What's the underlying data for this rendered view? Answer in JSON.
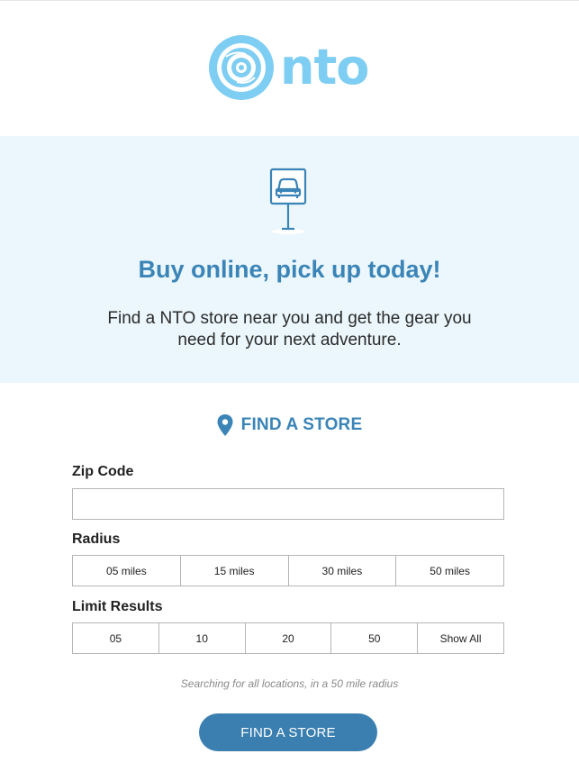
{
  "brand": {
    "logo_text": "nto",
    "logo_color": "#7ecdf2"
  },
  "hero": {
    "icon": "parking-sign-car-icon",
    "title": "Buy online, pick up today!",
    "text": "Find a NTO store near you and get the gear you need for your next adventure.",
    "background": "#ebf7fc"
  },
  "finder": {
    "heading": "FIND A STORE",
    "heading_icon": "map-pin-icon",
    "zip_label": "Zip Code",
    "zip_value": "",
    "radius_label": "Radius",
    "radius_options": [
      "05 miles",
      "15 miles",
      "30 miles",
      "50 miles"
    ],
    "limit_label": "Limit Results",
    "limit_options": [
      "05",
      "10",
      "20",
      "50",
      "Show All"
    ],
    "search_note": "Searching for all locations, in a 50 mile radius",
    "submit_label": "FIND A STORE",
    "accent_color": "#3b84b7",
    "button_color": "#3b7fb0"
  }
}
